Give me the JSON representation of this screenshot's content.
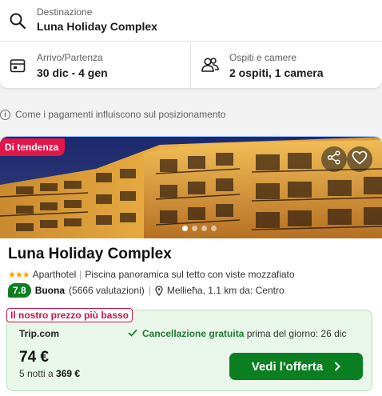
{
  "search": {
    "destination_label": "Destinazione",
    "destination_value": "Luna Holiday Complex",
    "dates_label": "Arrivo/Partenza",
    "dates_value": "30 dic - 4 gen",
    "guests_label": "Ospiti e camere",
    "guests_value": "2 ospiti, 1 camera"
  },
  "info": {
    "text": "Come i pagamenti influiscono sul posizionamento"
  },
  "hotel": {
    "badge": "Di tendenza",
    "name": "Luna Holiday Complex",
    "type": "Aparthotel",
    "stars": 3,
    "stars_text": "★★★",
    "separator": "|",
    "feature": "Piscina panoramica sul tetto con viste mozzafiato",
    "rating": "7.8",
    "rating_word": "Buona",
    "reviews": "(5666 valutazioni)",
    "location": "Mellieħa, 1.1 km da: Centro",
    "photo_count_dots": 4,
    "active_photo": 0
  },
  "offer": {
    "tag": "Il nostro prezzo più basso",
    "provider": "Trip.com",
    "cancel_bold": "Cancellazione gratuita",
    "cancel_rest": "prima del giorno: 26 dic",
    "price": "74 €",
    "nights": "5 notti a",
    "total": "369 €",
    "cta": "Vedi l'offerta"
  },
  "colors": {
    "accent_green": "#0a7f22",
    "badge_red": "#e3164a",
    "tag_red": "#c4164c",
    "offer_bg": "#e9f7ea"
  }
}
